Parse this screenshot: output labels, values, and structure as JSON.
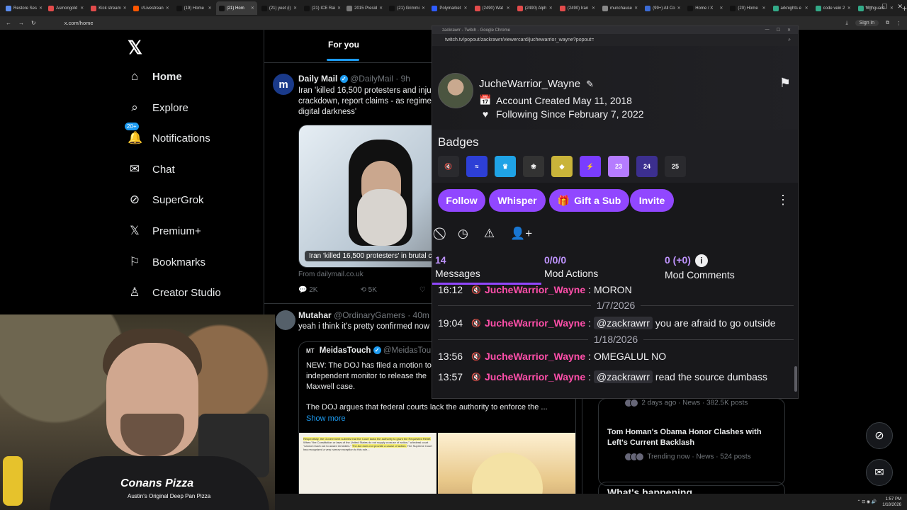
{
  "browser": {
    "tabs": [
      {
        "label": "Restore Ses",
        "color": "#5b8def"
      },
      {
        "label": "Asmongold",
        "color": "#e24b4b"
      },
      {
        "label": "Kick stream",
        "color": "#e24b4b"
      },
      {
        "label": "r/Livestrean",
        "color": "#ff5700"
      },
      {
        "label": "(19) Home",
        "color": "#111"
      },
      {
        "label": "(21) Hom",
        "color": "#111",
        "active": true
      },
      {
        "label": "(21) yeet (i)",
        "color": "#111"
      },
      {
        "label": "(21) ICE Rai",
        "color": "#111"
      },
      {
        "label": "2015 Presid",
        "color": "#777"
      },
      {
        "label": "(21) Grimmi",
        "color": "#111"
      },
      {
        "label": "Polymarket",
        "color": "#2e5cff"
      },
      {
        "label": "(2490) Wat",
        "color": "#e24b4b"
      },
      {
        "label": "(2490) Alph",
        "color": "#e24b4b"
      },
      {
        "label": "(2490) Iran",
        "color": "#e24b4b"
      },
      {
        "label": "munchause",
        "color": "#888"
      },
      {
        "label": "(99+) All Co",
        "color": "#3b6bd6"
      },
      {
        "label": "Home / X",
        "color": "#111"
      },
      {
        "label": "(20) Home",
        "color": "#111"
      },
      {
        "label": "arknights e",
        "color": "#3a8"
      },
      {
        "label": "code vein 2",
        "color": "#3a8"
      },
      {
        "label": "highguard",
        "color": "#3a8"
      }
    ],
    "url": "x.com/home",
    "signin": "Sign in"
  },
  "x_nav": {
    "items": [
      {
        "name": "home",
        "label": "Home",
        "icon": "⌂"
      },
      {
        "name": "explore",
        "label": "Explore",
        "icon": "⌕"
      },
      {
        "name": "notifications",
        "label": "Notifications",
        "icon": "🔔",
        "badge": "20+"
      },
      {
        "name": "chat",
        "label": "Chat",
        "icon": "✉"
      },
      {
        "name": "supergrok",
        "label": "SuperGrok",
        "icon": "⊘"
      },
      {
        "name": "premium",
        "label": "Premium+",
        "icon": "𝕏"
      },
      {
        "name": "bookmarks",
        "label": "Bookmarks",
        "icon": "⚐"
      },
      {
        "name": "creator-studio",
        "label": "Creator Studio",
        "icon": "♙"
      }
    ]
  },
  "feed": {
    "tab_label": "For you",
    "tweet1": {
      "name": "Daily Mail",
      "handle": "@DailyMail · 9h",
      "text": "Iran 'killed 16,500 protesters and inju crackdown, report claims - as regime digital darkness'",
      "image_caption": "Iran 'killed 16,500 protesters' in brutal c",
      "from": "From dailymail.co.uk",
      "replies": "2K",
      "reposts": "5K"
    },
    "tweet2": {
      "name": "Mutahar",
      "handle": "@OrdinaryGamers · 40m",
      "text": "yeah i think it's pretty confirmed now",
      "quote_name": "MeidasTouch",
      "quote_handle": "@MeidasTou",
      "quote_text": "NEW: The DOJ has filed a motion to independent monitor to release the Maxwell case.",
      "quote_text2": "The DOJ argues that federal courts lack the authority to enforce the ...",
      "show_more": "Show more"
    }
  },
  "right": {
    "trend1_meta": "2 days ago · News · 382.5K posts",
    "trend2_title": "Tom Homan's Obama Honor Clashes with Left's Current Backlash",
    "trend2_meta": "Trending now · News · 524 posts",
    "whats_happening": "What's happening"
  },
  "twitch": {
    "window_title": "zackrawrr - Twitch - Google Chrome",
    "url": "twitch.tv/popout/zackrawrr/viewercard/juchewarrior_wayne?popout=",
    "username": "JucheWarrior_Wayne",
    "account_created": "Account Created May 11, 2018",
    "following_since": "Following Since February 7, 2022",
    "badges_title": "Badges",
    "badges": [
      {
        "label": "🔇",
        "color": "#2a2a2e"
      },
      {
        "label": "≈",
        "color": "#2d3fd6"
      },
      {
        "label": "♛",
        "color": "#1fa3e6"
      },
      {
        "label": "❀",
        "color": "#333"
      },
      {
        "label": "◆",
        "color": "#c9b43a"
      },
      {
        "label": "⚡",
        "color": "#7a3cff"
      },
      {
        "label": "23",
        "color": "#b57cff"
      },
      {
        "label": "24",
        "color": "#3c2f8f"
      },
      {
        "label": "25",
        "color": "#2a2a2e"
      }
    ],
    "buttons": {
      "follow": "Follow",
      "whisper": "Whisper",
      "gift": "Gift a Sub",
      "invite": "Invite"
    },
    "stats": {
      "messages_num": "14",
      "messages_label": "Messages",
      "mod_actions_num": "0/0/0",
      "mod_actions_label": "Mod Actions",
      "mod_comments_num": "0 (+0)",
      "mod_comments_label": "Mod Comments"
    },
    "chat": [
      {
        "ts": "16:12",
        "user": "JucheWarrior_Wayne",
        "mention": "",
        "text": "MORON"
      },
      {
        "date": "1/7/2026"
      },
      {
        "ts": "19:04",
        "user": "JucheWarrior_Wayne",
        "mention": "@zackrawrr",
        "text": "you are afraid to go outside"
      },
      {
        "date": "1/18/2026"
      },
      {
        "ts": "13:56",
        "user": "JucheWarrior_Wayne",
        "mention": "",
        "text": "OMEGALUL NO"
      },
      {
        "ts": "13:57",
        "user": "JucheWarrior_Wayne",
        "mention": "@zackrawrr",
        "text": "read the source dumbass"
      }
    ]
  },
  "webcam": {
    "shirt_text": "Conans Pizza",
    "shirt_sub": "Austin's Original   Deep Pan Pizza"
  },
  "taskbar": {
    "time": "1:57 PM",
    "date": "1/18/2026"
  }
}
